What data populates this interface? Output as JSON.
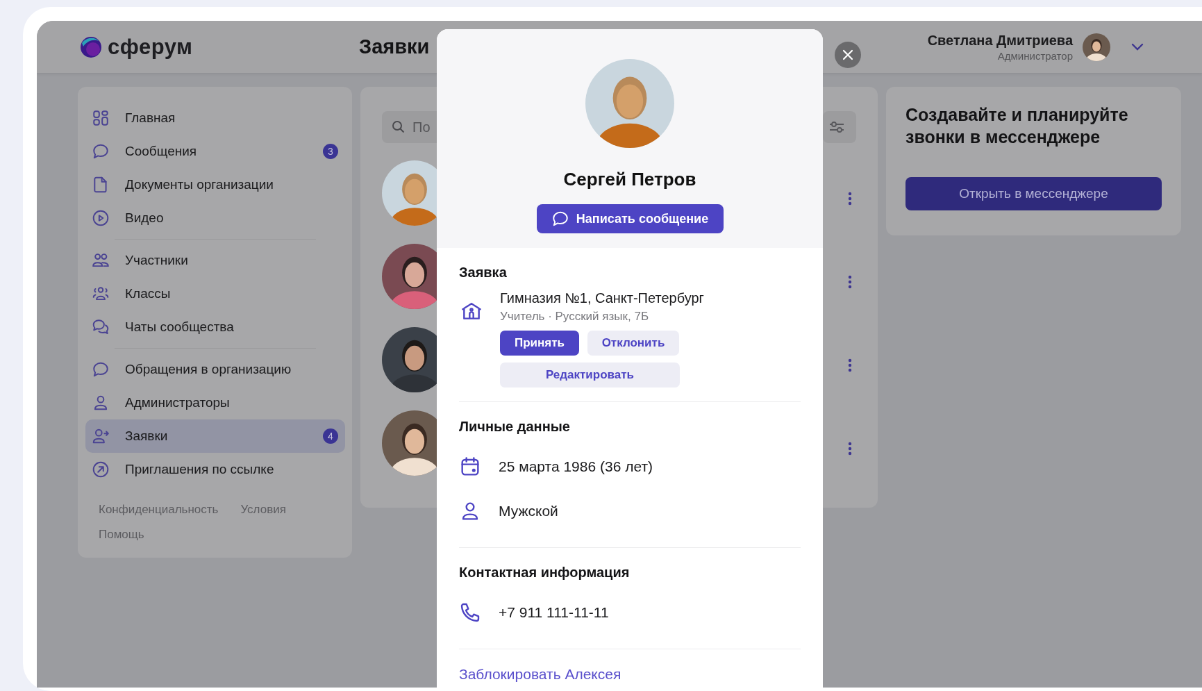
{
  "header": {
    "logo": "сферум",
    "title": "Заявки",
    "user": {
      "name": "Светлана Дмитриева",
      "role": "Администратор"
    }
  },
  "sidebar": {
    "groups": [
      {
        "items": [
          {
            "label": "Главная",
            "selected": false
          },
          {
            "label": "Сообщения",
            "badge": "3",
            "selected": false
          },
          {
            "label": "Документы организации",
            "selected": false
          },
          {
            "label": "Видео",
            "selected": false
          }
        ]
      },
      {
        "items": [
          {
            "label": "Участники",
            "selected": false
          },
          {
            "label": "Классы",
            "selected": false
          },
          {
            "label": "Чаты сообщества",
            "selected": false
          }
        ]
      },
      {
        "items": [
          {
            "label": "Обращения в организацию",
            "selected": false
          },
          {
            "label": "Администраторы",
            "selected": false
          },
          {
            "label": "Заявки",
            "badge": "4",
            "selected": true
          },
          {
            "label": "Приглашения по ссылке",
            "selected": false
          }
        ]
      }
    ],
    "footer_links": [
      "Конфиденциальность",
      "Условия",
      "Помощь"
    ]
  },
  "requests": {
    "search": {
      "placeholder": "По"
    }
  },
  "promo": {
    "title": "Создавайте и планируйте звонки в мессенджере",
    "button": "Открыть в мессенджере"
  },
  "profile": {
    "name": "Сергей Петров",
    "message_button": "Написать сообщение",
    "request": {
      "heading": "Заявка",
      "organization": "Гимназия №1, Санкт-Петербург",
      "details": "Учитель · Русский язык, 7Б",
      "actions": [
        {
          "label": "Принять",
          "kind": "primary"
        },
        {
          "label": "Отклонить",
          "kind": "secondary"
        },
        {
          "label": "Редактировать",
          "kind": "wide"
        }
      ]
    },
    "personal": {
      "heading": "Личные данные",
      "birth_date": "25 марта 1986 (36 лет)",
      "gender": "Мужской"
    },
    "contacts": {
      "heading": "Контактная информация",
      "phone": "+7 911 111-11-11"
    },
    "block_link": "Заблокировать Алексея"
  }
}
